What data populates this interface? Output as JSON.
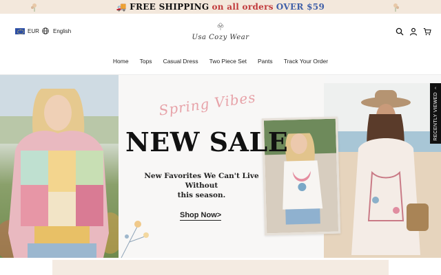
{
  "announcement": {
    "part1": "FREE SHIPPING",
    "part2": "on all orders",
    "part3": "OVER $59",
    "icon": "truck-icon",
    "colors": {
      "bg": "#f3e8dc",
      "red": "#c0393b",
      "blue": "#3f5fa8"
    }
  },
  "header": {
    "currency": "EUR",
    "language": "English",
    "logo_text": "Usa Cozy Wear",
    "icons": [
      "search-icon",
      "user-icon",
      "cart-icon"
    ]
  },
  "nav": {
    "items": [
      "Home",
      "Tops",
      "Casual Dress",
      "Two Piece Set",
      "Pants",
      "Track Your Order"
    ]
  },
  "hero": {
    "script": "Spring Vibes",
    "headline": "NEW SALE",
    "subline1": "New Favorites We Can't Live Without",
    "subline2": "this season.",
    "cta": "Shop Now>"
  },
  "recently_viewed": {
    "label": "RECENTLY VIEWED"
  }
}
